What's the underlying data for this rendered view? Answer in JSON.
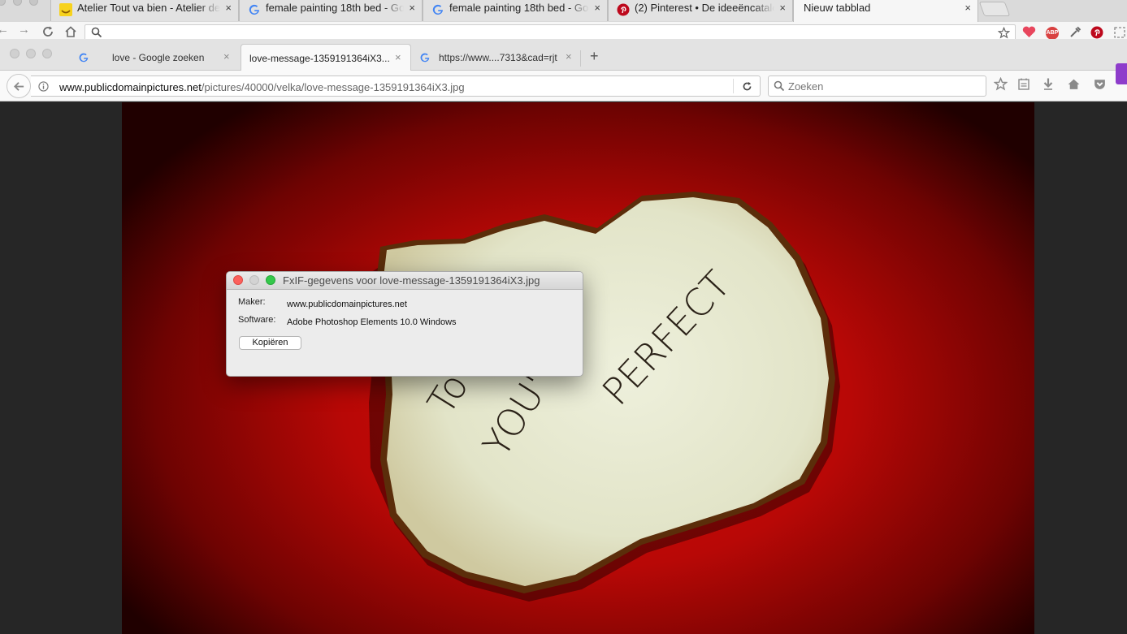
{
  "outer_browser": {
    "tabs": [
      {
        "title": "Atelier Tout va bien - Atelier de",
        "icon": "smiley-favicon"
      },
      {
        "title": "female painting 18th bed - Goo",
        "icon": "google-favicon"
      },
      {
        "title": "female painting 18th bed - Goo",
        "icon": "google-favicon"
      },
      {
        "title": "(2) Pinterest • De ideeëncatalo",
        "icon": "pinterest-favicon"
      },
      {
        "title": "Nieuw tabblad",
        "icon": "",
        "active": true
      }
    ],
    "extensions": {
      "abp_label": "ABP"
    }
  },
  "inner_browser": {
    "tabs": [
      {
        "title": "love - Google zoeken",
        "icon": "google-favicon"
      },
      {
        "title": "love-message-1359191364iX3....",
        "icon": "",
        "active": true
      },
      {
        "title": "https://www....7313&cad=rjt",
        "icon": "google-favicon"
      }
    ],
    "new_tab_symbol": "+",
    "close_symbol": "×",
    "url": {
      "domain": "www.publicdomainpictures.net",
      "path": "/pictures/40000/velka/love-message-1359191364iX3.jpg"
    },
    "search_placeholder": "Zoeken"
  },
  "photo": {
    "handwriting_lines": [
      "To",
      "YOU'",
      "PERFECT"
    ]
  },
  "exif_dialog": {
    "title": "FxIF-gegevens voor love-message-1359191364iX3.jpg",
    "fields": [
      {
        "label": "Maker:",
        "value": "www.publicdomainpictures.net"
      },
      {
        "label": "Software:",
        "value": "Adobe Photoshop Elements 10.0 Windows"
      }
    ],
    "copy_button": "Kopiëren"
  },
  "colors": {
    "google_blue": "#4285f4",
    "pinterest_red": "#bd081c",
    "dialog_close": "#fc605c",
    "dialog_zoom": "#34c84a",
    "photo_red": "#c80a06",
    "paper": "#e8ead2"
  }
}
